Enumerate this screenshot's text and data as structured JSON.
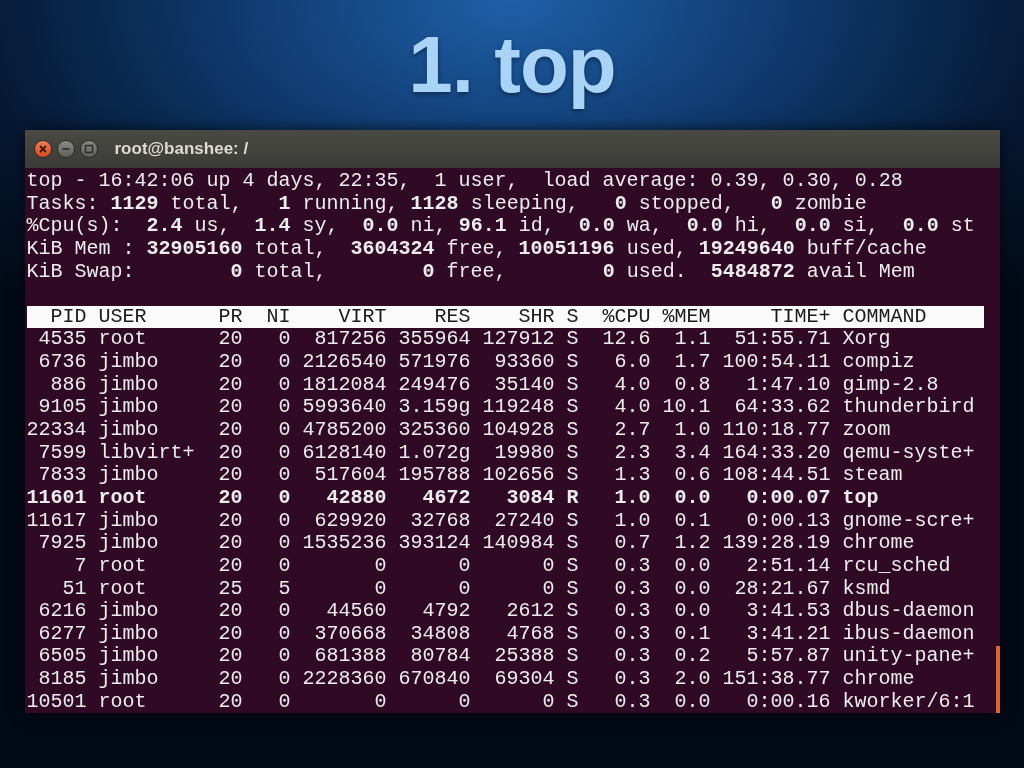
{
  "slide": {
    "title": "1. top"
  },
  "window": {
    "title": "root@banshee: /"
  },
  "summary": [
    "top - 16:42:06 up 4 days, 22:35,  1 user,  load average: 0.39, 0.30, 0.28",
    "Tasks: **1129** total,   **1** running, **1128** sleeping,   **0** stopped,   **0** zombie",
    "%Cpu(s):  **2.4** us,  **1.4** sy,  **0.0** ni, **96.1** id,  **0.0** wa,  **0.0** hi,  **0.0** si,  **0.0** st",
    "KiB Mem : **32905160** total,  **3604324** free, **10051196** used, **19249640** buff/cache",
    "KiB Swap:        **0** total,        **0** free,        **0** used.  **5484872** avail Mem"
  ],
  "table": {
    "columns": [
      "PID",
      "USER",
      "PR",
      "NI",
      "VIRT",
      "RES",
      "SHR",
      "S",
      "%CPU",
      "%MEM",
      "TIME+",
      "COMMAND"
    ],
    "rows": [
      {
        "bold": false,
        "cells": [
          "4535",
          "root",
          "20",
          "0",
          "817256",
          "355964",
          "127912",
          "S",
          "12.6",
          "1.1",
          "51:55.71",
          "Xorg"
        ]
      },
      {
        "bold": false,
        "cells": [
          "6736",
          "jimbo",
          "20",
          "0",
          "2126540",
          "571976",
          "93360",
          "S",
          "6.0",
          "1.7",
          "100:54.11",
          "compiz"
        ]
      },
      {
        "bold": false,
        "cells": [
          "886",
          "jimbo",
          "20",
          "0",
          "1812084",
          "249476",
          "35140",
          "S",
          "4.0",
          "0.8",
          "1:47.10",
          "gimp-2.8"
        ]
      },
      {
        "bold": false,
        "cells": [
          "9105",
          "jimbo",
          "20",
          "0",
          "5993640",
          "3.159g",
          "119248",
          "S",
          "4.0",
          "10.1",
          "64:33.62",
          "thunderbird"
        ]
      },
      {
        "bold": false,
        "cells": [
          "22334",
          "jimbo",
          "20",
          "0",
          "4785200",
          "325360",
          "104928",
          "S",
          "2.7",
          "1.0",
          "110:18.77",
          "zoom"
        ]
      },
      {
        "bold": false,
        "cells": [
          "7599",
          "libvirt+",
          "20",
          "0",
          "6128140",
          "1.072g",
          "19980",
          "S",
          "2.3",
          "3.4",
          "164:33.20",
          "qemu-syste+"
        ]
      },
      {
        "bold": false,
        "cells": [
          "7833",
          "jimbo",
          "20",
          "0",
          "517604",
          "195788",
          "102656",
          "S",
          "1.3",
          "0.6",
          "108:44.51",
          "steam"
        ]
      },
      {
        "bold": true,
        "cells": [
          "11601",
          "root",
          "20",
          "0",
          "42880",
          "4672",
          "3084",
          "R",
          "1.0",
          "0.0",
          "0:00.07",
          "top"
        ]
      },
      {
        "bold": false,
        "cells": [
          "11617",
          "jimbo",
          "20",
          "0",
          "629920",
          "32768",
          "27240",
          "S",
          "1.0",
          "0.1",
          "0:00.13",
          "gnome-scre+"
        ]
      },
      {
        "bold": false,
        "cells": [
          "7925",
          "jimbo",
          "20",
          "0",
          "1535236",
          "393124",
          "140984",
          "S",
          "0.7",
          "1.2",
          "139:28.19",
          "chrome"
        ]
      },
      {
        "bold": false,
        "cells": [
          "7",
          "root",
          "20",
          "0",
          "0",
          "0",
          "0",
          "S",
          "0.3",
          "0.0",
          "2:51.14",
          "rcu_sched"
        ]
      },
      {
        "bold": false,
        "cells": [
          "51",
          "root",
          "25",
          "5",
          "0",
          "0",
          "0",
          "S",
          "0.3",
          "0.0",
          "28:21.67",
          "ksmd"
        ]
      },
      {
        "bold": false,
        "cells": [
          "6216",
          "jimbo",
          "20",
          "0",
          "44560",
          "4792",
          "2612",
          "S",
          "0.3",
          "0.0",
          "3:41.53",
          "dbus-daemon"
        ]
      },
      {
        "bold": false,
        "cells": [
          "6277",
          "jimbo",
          "20",
          "0",
          "370668",
          "34808",
          "4768",
          "S",
          "0.3",
          "0.1",
          "3:41.21",
          "ibus-daemon"
        ]
      },
      {
        "bold": false,
        "cells": [
          "6505",
          "jimbo",
          "20",
          "0",
          "681388",
          "80784",
          "25388",
          "S",
          "0.3",
          "0.2",
          "5:57.87",
          "unity-pane+"
        ]
      },
      {
        "bold": false,
        "cells": [
          "8185",
          "jimbo",
          "20",
          "0",
          "2228360",
          "670840",
          "69304",
          "S",
          "0.3",
          "2.0",
          "151:38.77",
          "chrome"
        ]
      },
      {
        "bold": false,
        "cells": [
          "10501",
          "root",
          "20",
          "0",
          "0",
          "0",
          "0",
          "S",
          "0.3",
          "0.0",
          "0:00.16",
          "kworker/6:1"
        ]
      }
    ]
  }
}
